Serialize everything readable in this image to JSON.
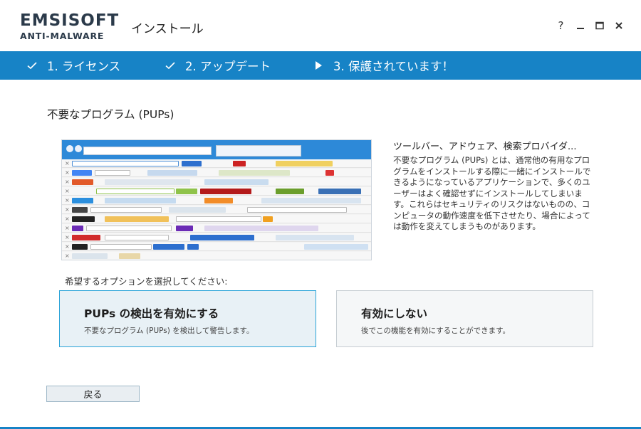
{
  "brand": {
    "name": "EMSISOFT",
    "sub": "ANTI-MALWARE"
  },
  "window": {
    "title": "インストール",
    "help": "?"
  },
  "steps": [
    {
      "label": "1. ライセンス",
      "state": "done"
    },
    {
      "label": "2. アップデート",
      "state": "done"
    },
    {
      "label": "3. 保護されています！",
      "state": "current"
    }
  ],
  "section_title": "不要なプログラム (PUPs)",
  "pup_info": {
    "heading": "ツールバー、アドウェア、検索プロバイダ...",
    "body": "不要なプログラム (PUPs) とは、通常他の有用なプログラムをインストールする際に一緒にインストールできるようになっているアプリケーションで、多くのユーザーはよく確認せずにインストールしてしまいます。これらはセキュリティのリスクはないものの、コンピュータの動作速度を低下させたり、場合によっては動作を変えてしまうものがあります。"
  },
  "prompt": "希望するオプションを選択してください:",
  "options": [
    {
      "title": "PUPs の検出を有効にする",
      "desc": "不要なプログラム (PUPs) を検出して警告します。",
      "selected": true
    },
    {
      "title": "有効にしない",
      "desc": "後でこの機能を有効にすることができます。",
      "selected": false
    }
  ],
  "back_button": "戻る",
  "colors": {
    "accent": "#1783c6",
    "selected_border": "#29a3d8",
    "selected_bg": "#e8f1f6"
  }
}
